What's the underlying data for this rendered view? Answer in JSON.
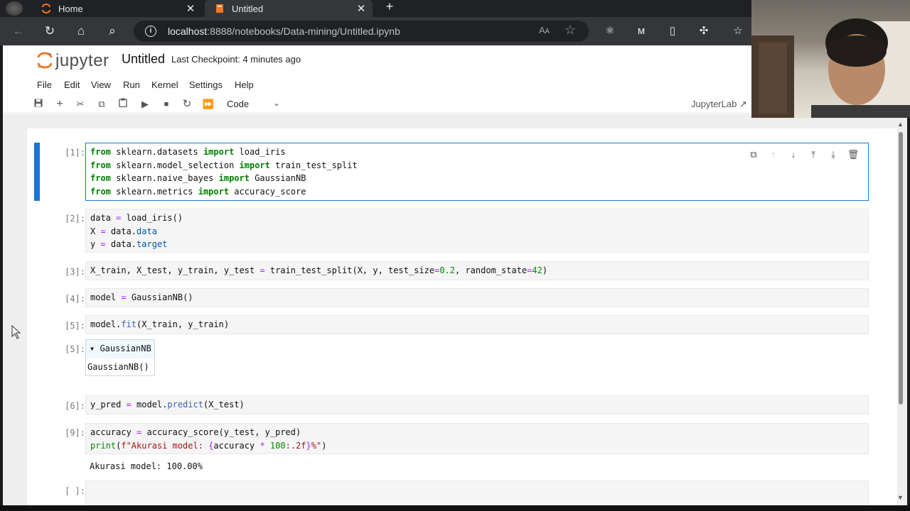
{
  "browser": {
    "tabs": [
      {
        "label": "Home",
        "active": false
      },
      {
        "label": "Untitled",
        "active": true
      }
    ],
    "new_tab_label": "+",
    "url_host": "localhost",
    "url_rest": ":8888/notebooks/Data-mining/Untitled.ipynb",
    "read_aloud_label": "Aᴀ"
  },
  "jupyter": {
    "logo_text": "jupyter",
    "notebook_title": "Untitled",
    "checkpoint": "Last Checkpoint: 4 minutes ago",
    "menu": [
      "File",
      "Edit",
      "View",
      "Run",
      "Kernel",
      "Settings",
      "Help"
    ],
    "cell_type": "Code",
    "jupyterlab_link": "JupyterLab ↗"
  },
  "cells": [
    {
      "prompt": "[1]:"
    },
    {
      "prompt": "[2]:"
    },
    {
      "prompt": "[3]:"
    },
    {
      "prompt": "[4]:"
    },
    {
      "prompt": "[5]:"
    },
    {
      "prompt": "[5]:",
      "estimator_name": "▾ GaussianNB",
      "estimator_repr": "GaussianNB()"
    },
    {
      "prompt": "[6]:"
    },
    {
      "prompt": "[9]:",
      "output": "Akurasi model: 100.00%"
    },
    {
      "prompt": "[ ]:"
    }
  ],
  "code": {
    "c1_l1": [
      "from",
      " sklearn.datasets ",
      "import",
      " load_iris"
    ],
    "c1_l2": [
      "from",
      " sklearn.model_selection ",
      "import",
      " train_test_split"
    ],
    "c1_l3": [
      "from",
      " sklearn.naive_bayes ",
      "import",
      " GaussianNB"
    ],
    "c1_l4": [
      "from",
      " sklearn.metrics ",
      "import",
      " accuracy_score"
    ],
    "c2_l1": [
      "data ",
      "=",
      " load_iris()"
    ],
    "c2_l2": [
      "X ",
      "=",
      " data.",
      "data"
    ],
    "c2_l3": [
      "y ",
      "=",
      " data.",
      "target"
    ],
    "c3_l1": [
      "X_train, X_test, y_train, y_test ",
      "=",
      " train_test_split(X, y, test_size",
      "=",
      "0.2",
      ", random_state",
      "=",
      "42",
      ")"
    ],
    "c4_l1": [
      "model ",
      "=",
      " GaussianNB()"
    ],
    "c5_l1": [
      "model.",
      "fit",
      "(X_train, y_train)"
    ],
    "c6_l1": [
      "y_pred ",
      "=",
      " model.",
      "predict",
      "(X_test)"
    ],
    "c9_l1": [
      "accuracy ",
      "=",
      " accuracy_score(y_test, y_pred)"
    ],
    "c9_l2": [
      "print",
      "(",
      "f\"Akurasi model: ",
      "{",
      "accuracy ",
      "*",
      " ",
      "100",
      ":.2f",
      "}",
      "%\"",
      ")"
    ]
  },
  "colors": {
    "accent": "#1976d2",
    "jupyter_orange": "#f37726",
    "keyword": "#008000",
    "number": "#008800"
  }
}
